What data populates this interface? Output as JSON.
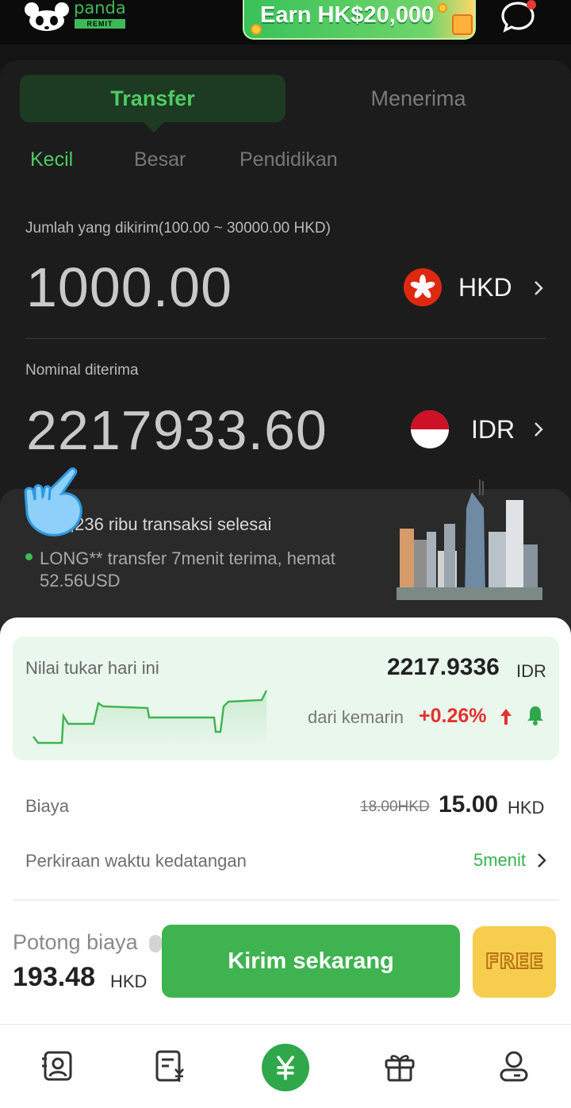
{
  "header": {
    "logo_word": "panda",
    "logo_sub": "REMIT",
    "banner_text": "Earn HK$20,000"
  },
  "tabs": [
    {
      "label": "Transfer",
      "active": true
    },
    {
      "label": "Menerima",
      "active": false
    }
  ],
  "subtabs": [
    {
      "label": "Kecil",
      "active": true
    },
    {
      "label": "Besar",
      "active": false
    },
    {
      "label": "Pendidikan",
      "active": false
    }
  ],
  "send": {
    "label": "Jumlah yang dikirim(100.00 ~ 30000.00 HKD)",
    "amount": "1000.00",
    "currency": "HKD",
    "flag_icon": "hong-kong-flag-icon"
  },
  "receive": {
    "label": "Nominal diterima",
    "amount": "2217933.60",
    "currency": "IDR",
    "flag_icon": "indonesia-flag-icon"
  },
  "stats": {
    "line1_suffix": ",236 ribu transaksi selesai",
    "line2": "LONG** transfer 7menit terima, hemat 52.56USD"
  },
  "rate": {
    "label": "Nilai tukar hari ini",
    "value": "2217.9336",
    "unit": "IDR",
    "from_label": "dari kemarin",
    "change": "+0.26%",
    "trend": "up"
  },
  "fee": {
    "label": "Biaya",
    "old": "18.00HKD",
    "new": "15.00",
    "unit": "HKD"
  },
  "eta": {
    "label": "Perkiraan waktu kedatangan",
    "value": "5menit"
  },
  "discount": {
    "label": "Potong biaya",
    "value": "193.48",
    "unit": "HKD"
  },
  "actions": {
    "send_label": "Kirim sekarang",
    "free_label": "FREE"
  },
  "nav": [
    "contacts-icon",
    "orders-icon",
    "remit-icon",
    "gift-icon",
    "profile-icon"
  ],
  "colors": {
    "accent": "#3fb350",
    "dark_bg": "#1c1c1c",
    "increase": "#e2322e",
    "badge": "#f7cd4e"
  }
}
